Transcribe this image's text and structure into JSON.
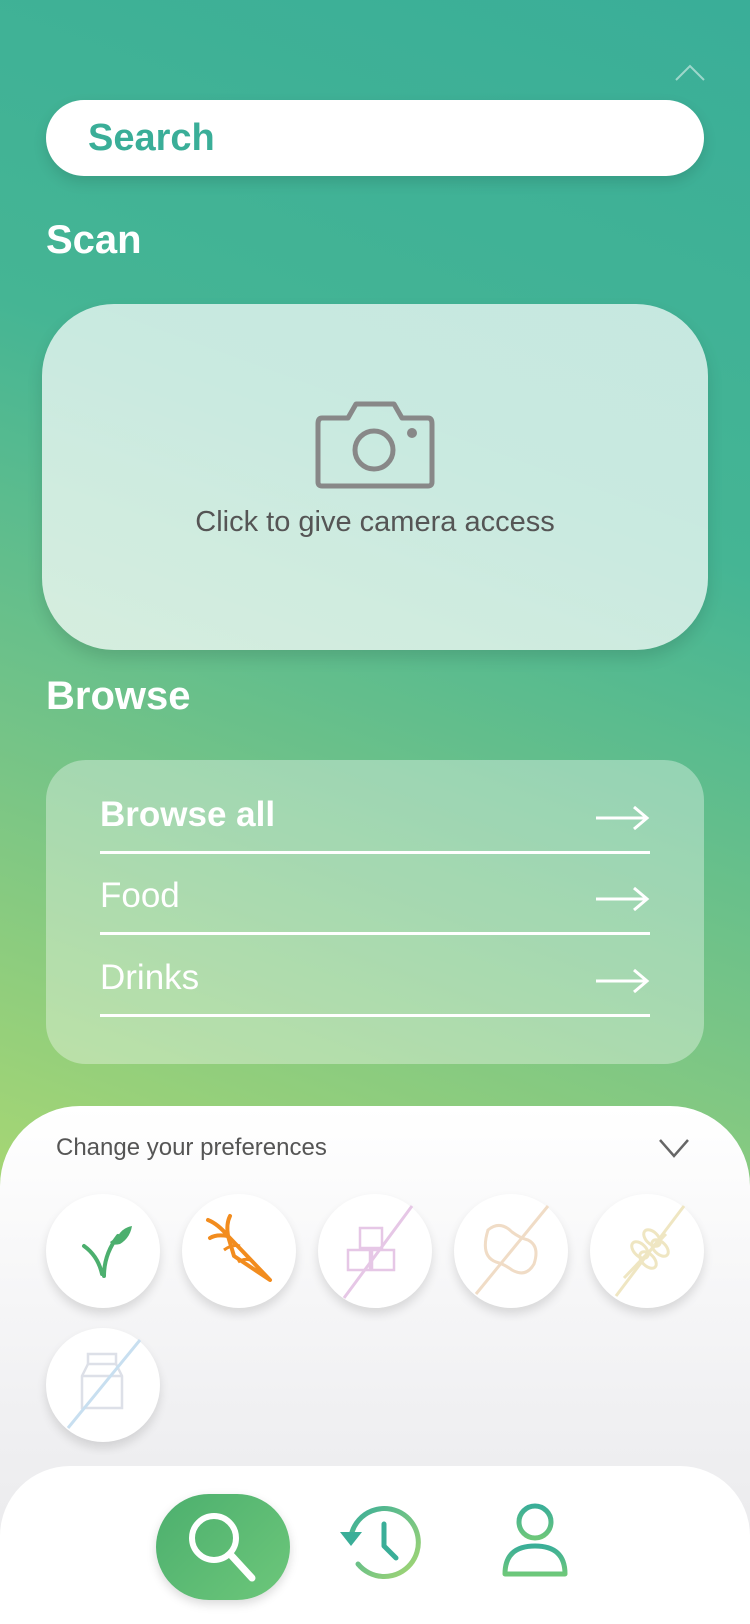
{
  "search": {
    "placeholder": "Search"
  },
  "scan": {
    "title": "Scan",
    "camera_prompt": "Click to give camera access"
  },
  "browse": {
    "title": "Browse",
    "items": [
      {
        "label": "Browse all",
        "bold": true
      },
      {
        "label": "Food",
        "bold": false
      },
      {
        "label": "Drinks",
        "bold": false
      }
    ]
  },
  "preferences": {
    "title": "Change your preferences",
    "options": [
      {
        "icon": "vegan-leaf-icon",
        "active": true
      },
      {
        "icon": "carrot-icon",
        "active": true
      },
      {
        "icon": "no-sugar-icon",
        "active": false
      },
      {
        "icon": "no-peanut-icon",
        "active": false
      },
      {
        "icon": "no-gluten-icon",
        "active": false
      },
      {
        "icon": "no-dairy-icon",
        "active": false
      }
    ]
  },
  "nav": {
    "items": [
      "search-icon",
      "history-icon",
      "profile-icon"
    ],
    "active": "search-icon"
  },
  "colors": {
    "brand": "#3aae98",
    "accent": "#4caf6e",
    "carrot": "#f28c1e"
  }
}
